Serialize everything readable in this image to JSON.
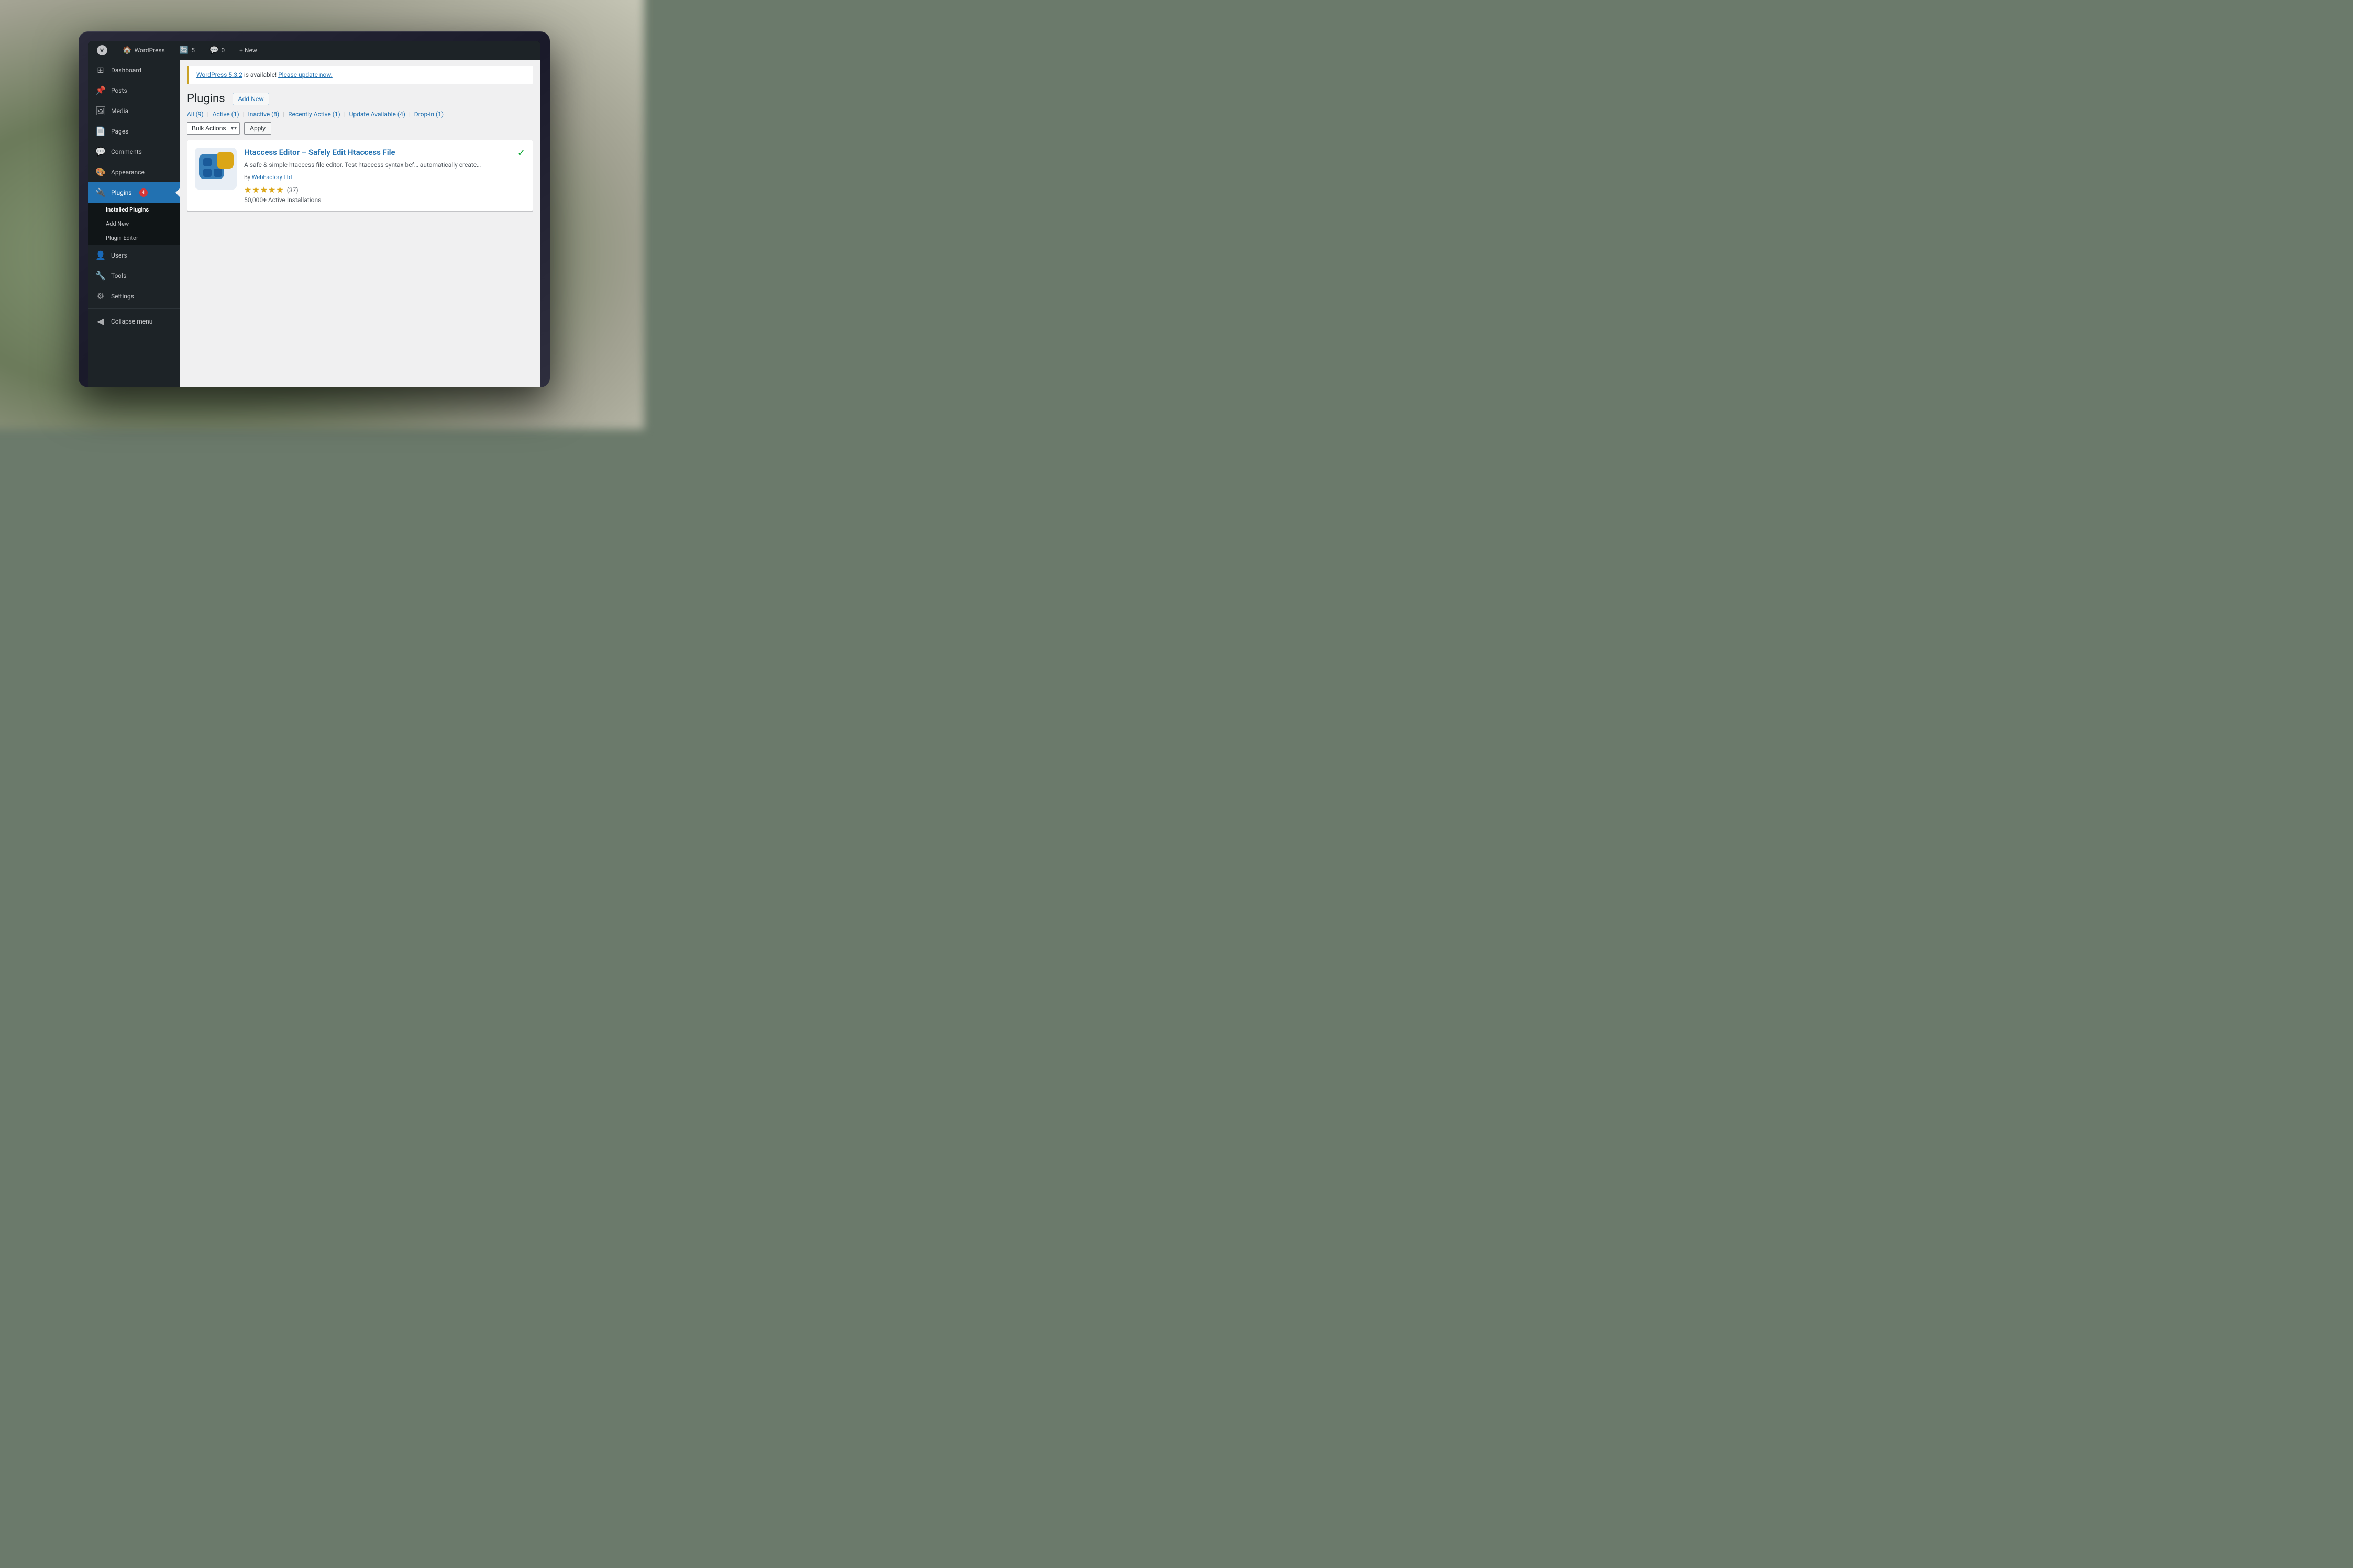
{
  "background": {
    "color": "#6b7a6b"
  },
  "adminBar": {
    "logo_alt": "WordPress",
    "site_name": "WordPress",
    "updates_count": "5",
    "comments_count": "0",
    "new_label": "+ New"
  },
  "sidebar": {
    "items": [
      {
        "id": "dashboard",
        "label": "Dashboard",
        "icon": "🏠"
      },
      {
        "id": "posts",
        "label": "Posts",
        "icon": "📌"
      },
      {
        "id": "media",
        "label": "Media",
        "icon": "🖼"
      },
      {
        "id": "pages",
        "label": "Pages",
        "icon": "📄"
      },
      {
        "id": "comments",
        "label": "Comments",
        "icon": "💬"
      },
      {
        "id": "appearance",
        "label": "Appearance",
        "icon": "🎨"
      },
      {
        "id": "plugins",
        "label": "Plugins",
        "icon": "🔌",
        "badge": "4",
        "active": true
      },
      {
        "id": "users",
        "label": "Users",
        "icon": "👤"
      },
      {
        "id": "tools",
        "label": "Tools",
        "icon": "🔧"
      },
      {
        "id": "settings",
        "label": "Settings",
        "icon": "⚙"
      },
      {
        "id": "collapse",
        "label": "Collapse menu",
        "icon": "◀"
      }
    ],
    "submenu": {
      "installed_plugins": "Installed Plugins",
      "add_new": "Add New",
      "plugin_editor": "Plugin Editor"
    }
  },
  "updateNotice": {
    "version_link": "WordPress 5.3.2",
    "message": " is available! ",
    "update_link": "Please update now."
  },
  "plugins": {
    "page_title": "Plugins",
    "add_new_button": "Add New",
    "filter_tabs": [
      {
        "label": "All",
        "count": "9"
      },
      {
        "label": "Active",
        "count": "1"
      },
      {
        "label": "Inactive",
        "count": "8"
      },
      {
        "label": "Recently Active",
        "count": "1"
      },
      {
        "label": "Update Available",
        "count": "4"
      },
      {
        "label": "Drop-in",
        "count": "1"
      }
    ],
    "bulk_actions_label": "Bulk Actions",
    "apply_label": "Apply",
    "items": [
      {
        "id": "htaccess-editor",
        "name": "Htaccess Editor – Safely Edit Htaccess File",
        "description": "A safe & simple htaccess file editor. Test htaccess syntax bef… automatically create…",
        "author": "WebFactory Ltd",
        "rating": 5,
        "rating_count": "37",
        "installs": "50,000+ Active Installations",
        "active": true
      }
    ]
  }
}
